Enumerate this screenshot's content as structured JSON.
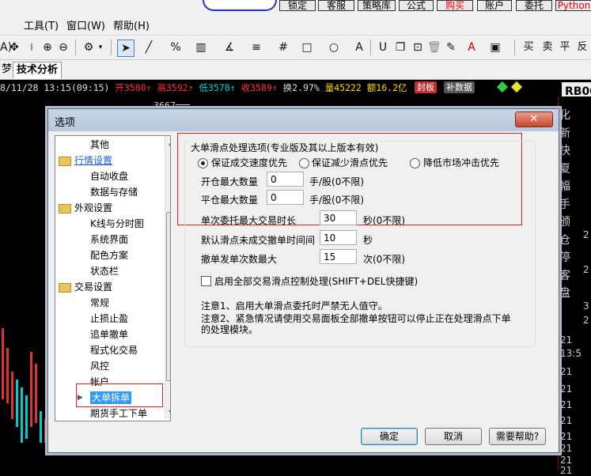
{
  "topbar": {
    "buttons": [
      "锁定",
      "客服",
      "策略库",
      "公式",
      "购买",
      "账户",
      "委托",
      "Python"
    ]
  },
  "menubar": {
    "items": [
      "工具(T)",
      "窗口(W)",
      "帮助(H)"
    ]
  },
  "tabs": {
    "left_partial": "梦",
    "active": "技术分析"
  },
  "infoline": {
    "date": "8/11/28 13:15(09:15)",
    "open": "开3580↑",
    "high": "高3592↑",
    "low": "低3578↑",
    "close": "收3589↑",
    "turnover": "换2.97%",
    "volume": "量45222",
    "amount": "额16.2亿",
    "badge1": "封板",
    "badge2": "补数据",
    "symbol": "RB00"
  },
  "chart": {
    "price_label": "3667"
  },
  "right_panel": {
    "chars": [
      "化",
      "新",
      "快",
      "夏",
      "幅",
      "手",
      "颁",
      "仓",
      "停",
      "客",
      "盘"
    ],
    "numbers": [
      "2",
      "2",
      "3",
      "2",
      "21",
      "13:5",
      "21",
      "21",
      "21",
      "21",
      "21",
      "21",
      "21",
      "21"
    ]
  },
  "dialog": {
    "title": "选项",
    "close": "✕",
    "tree": [
      {
        "label": "其他",
        "level": 1
      },
      {
        "label": "行情设置",
        "level": 0,
        "folder": true,
        "link": true
      },
      {
        "label": "自动收盘",
        "level": 1
      },
      {
        "label": "数据与存储",
        "level": 1
      },
      {
        "label": "外观设置",
        "level": 0,
        "folder": true
      },
      {
        "label": "K线与分时图",
        "level": 1
      },
      {
        "label": "系统界面",
        "level": 1
      },
      {
        "label": "配色方案",
        "level": 1
      },
      {
        "label": "状态栏",
        "level": 1
      },
      {
        "label": "交易设置",
        "level": 0,
        "folder": true
      },
      {
        "label": "常规",
        "level": 1
      },
      {
        "label": "止损止盈",
        "level": 1
      },
      {
        "label": "追单撤单",
        "level": 1
      },
      {
        "label": "程式化交易",
        "level": 1
      },
      {
        "label": "风控",
        "level": 1
      },
      {
        "label": "帐户",
        "level": 1
      },
      {
        "label": "大单拆单",
        "level": 1,
        "selected": true
      },
      {
        "label": "期货手工下单",
        "level": 1
      }
    ],
    "group_title": "大单滑点处理选项(专业版及其以上版本有效)",
    "radios": [
      {
        "label": "保证成交速度优先",
        "checked": true
      },
      {
        "label": "保证减少滑点优先",
        "checked": false
      },
      {
        "label": "降低市场冲击优先",
        "checked": false
      }
    ],
    "fields": {
      "open_max_label": "开仓最大数量",
      "open_max_value": "0",
      "open_max_unit": "手/股(0不限)",
      "close_max_label": "平仓最大数量",
      "close_max_value": "0",
      "close_max_unit": "手/股(0不限)",
      "order_time_label": "单次委托最大交易时长",
      "order_time_value": "30",
      "order_time_unit": "秒(0不限)",
      "cancel_interval_label": "默认滑点未成交撤单时间间",
      "cancel_interval_value": "10",
      "cancel_interval_unit": "秒",
      "max_cancel_label": "撤单发单次数最大",
      "max_cancel_value": "15",
      "max_cancel_unit": "次(0不限)"
    },
    "checkbox": {
      "label": "启用全部交易滑点控制处理(SHIFT+DEL快捷键)",
      "checked": false
    },
    "notes": [
      "注意1、启用大单滑点委托时严禁无人值守。",
      "注意2、紧急情况请使用交易面板全部撤单按钮可以停止正在处理滑点下单",
      "的处理模块。"
    ],
    "buttons": {
      "ok": "确定",
      "cancel": "取消",
      "help": "需要帮助?"
    }
  },
  "colors": {
    "highlight_box": "#e02020",
    "up": "#ff3030",
    "down": "#00d0d0",
    "accent": "#3399ff"
  }
}
